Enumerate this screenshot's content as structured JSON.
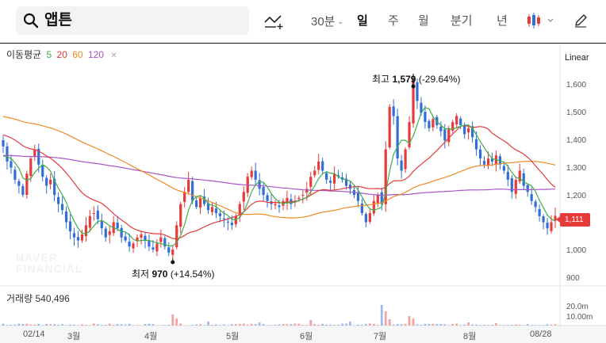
{
  "search": {
    "query": "앱튼"
  },
  "toolbar": {
    "interval": "30분",
    "periods": [
      "일",
      "주",
      "월",
      "분기",
      "년"
    ],
    "active_period": "일"
  },
  "colors": {
    "up": "#e63b3b",
    "down": "#2f6fd6",
    "ma5": "#3fae49",
    "ma20": "#e23b3b",
    "ma60": "#f08a24",
    "ma120": "#a855c7"
  },
  "chart_data": {
    "type": "candlestick",
    "legend": {
      "label": "이동평균",
      "items": [
        {
          "name": "5",
          "color": "#3fae49"
        },
        {
          "name": "20",
          "color": "#e23b3b"
        },
        {
          "name": "60",
          "color": "#f08a24"
        },
        {
          "name": "120",
          "color": "#a855c7"
        }
      ]
    },
    "scale": "Linear",
    "yticks": [
      "1,600",
      "1,500",
      "1,400",
      "1,300",
      "1,200",
      "1,000",
      "900"
    ],
    "ylim": [
      880,
      1650
    ],
    "current_price": "1,111",
    "high_annotation": {
      "label": "최고",
      "value": "1,579",
      "change": "(-29.64%)",
      "price": 1579,
      "index": 104
    },
    "low_annotation": {
      "label": "최저",
      "value": "970",
      "change": "(+14.54%)",
      "price": 970,
      "index": 43
    },
    "x_labels": [
      {
        "label": "02/14",
        "index": 7
      },
      {
        "label": "3월",
        "index": 17
      },
      {
        "label": "4월",
        "index": 37
      },
      {
        "label": "5월",
        "index": 58
      },
      {
        "label": "6월",
        "index": 77
      },
      {
        "label": "7월",
        "index": 96
      },
      {
        "label": "8월",
        "index": 118
      },
      {
        "label": "08/28",
        "index": 136
      }
    ],
    "volume": {
      "label": "거래량",
      "value": "540,496",
      "ticks": [
        "20.0m",
        "10.00m"
      ]
    },
    "closes": [
      1340,
      1290,
      1270,
      1230,
      1210,
      1180,
      1250,
      1300,
      1330,
      1280,
      1240,
      1210,
      1230,
      1180,
      1150,
      1130,
      1090,
      1060,
      1040,
      1030,
      1050,
      1080,
      1110,
      1120,
      1100,
      1070,
      1040,
      1060,
      1090,
      1070,
      1040,
      1030,
      1010,
      1020,
      1040,
      1050,
      1030,
      1010,
      1000,
      1020,
      1040,
      1010,
      990,
      1000,
      1080,
      1150,
      1190,
      1230,
      1160,
      1140,
      1170,
      1150,
      1130,
      1140,
      1120,
      1110,
      1100,
      1090,
      1080,
      1110,
      1150,
      1190,
      1240,
      1260,
      1230,
      1200,
      1180,
      1160,
      1150,
      1150,
      1140,
      1160,
      1170,
      1150,
      1160,
      1170,
      1180,
      1200,
      1240,
      1260,
      1290,
      1260,
      1230,
      1220,
      1250,
      1240,
      1230,
      1210,
      1200,
      1180,
      1160,
      1120,
      1090,
      1120,
      1160,
      1180,
      1150,
      1330,
      1470,
      1440,
      1300,
      1260,
      1330,
      1420,
      1560,
      1490,
      1450,
      1420,
      1400,
      1430,
      1410,
      1390,
      1360,
      1400,
      1420,
      1440,
      1410,
      1380,
      1400,
      1370,
      1330,
      1300,
      1280,
      1300,
      1290,
      1310,
      1280,
      1260,
      1230,
      1190,
      1230,
      1260,
      1210,
      1190,
      1160,
      1140,
      1110,
      1090,
      1070,
      1090,
      1111
    ]
  }
}
